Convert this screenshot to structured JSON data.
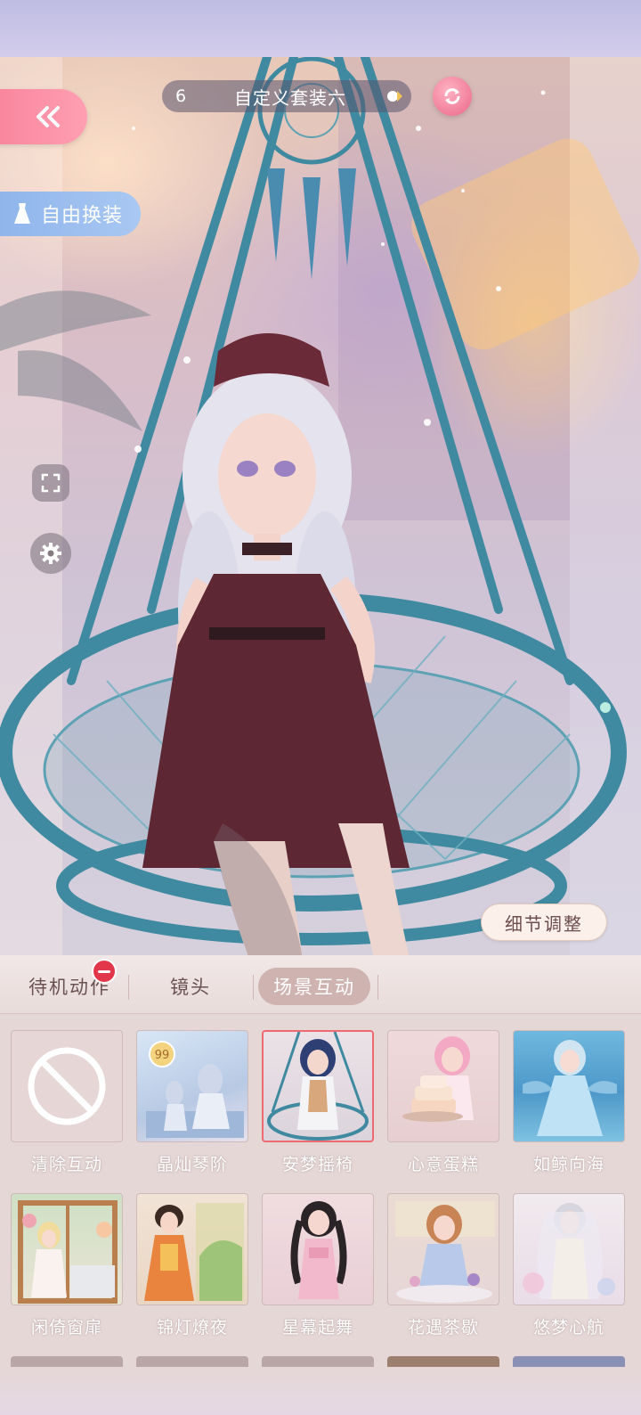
{
  "header": {
    "outfit_number": "6",
    "outfit_name": "自定义套装六"
  },
  "left_buttons": {
    "free_change_label": "自由换装"
  },
  "scene": {
    "detail_button_label": "细节调整"
  },
  "tabs": [
    {
      "label": "待机动作",
      "selected": false
    },
    {
      "label": "镜头",
      "selected": false
    },
    {
      "label": "场景互动",
      "selected": true
    }
  ],
  "items": [
    {
      "label": "清除互动",
      "selected": false
    },
    {
      "label": "晶灿琴阶",
      "selected": false
    },
    {
      "label": "安梦摇椅",
      "selected": true
    },
    {
      "label": "心意蛋糕",
      "selected": false
    },
    {
      "label": "如鲸向海",
      "selected": false
    },
    {
      "label": "闲倚窗扉",
      "selected": false
    },
    {
      "label": "锦灯燎夜",
      "selected": false
    },
    {
      "label": "星幕起舞",
      "selected": false
    },
    {
      "label": "花遇茶歇",
      "selected": false
    },
    {
      "label": "悠梦心航",
      "selected": false
    }
  ],
  "colors": {
    "accent_pink": "#f77f98",
    "accent_blue": "#8fb5ec",
    "selected_border": "#ee6a72",
    "panel_bg": "#e5d7d6"
  }
}
